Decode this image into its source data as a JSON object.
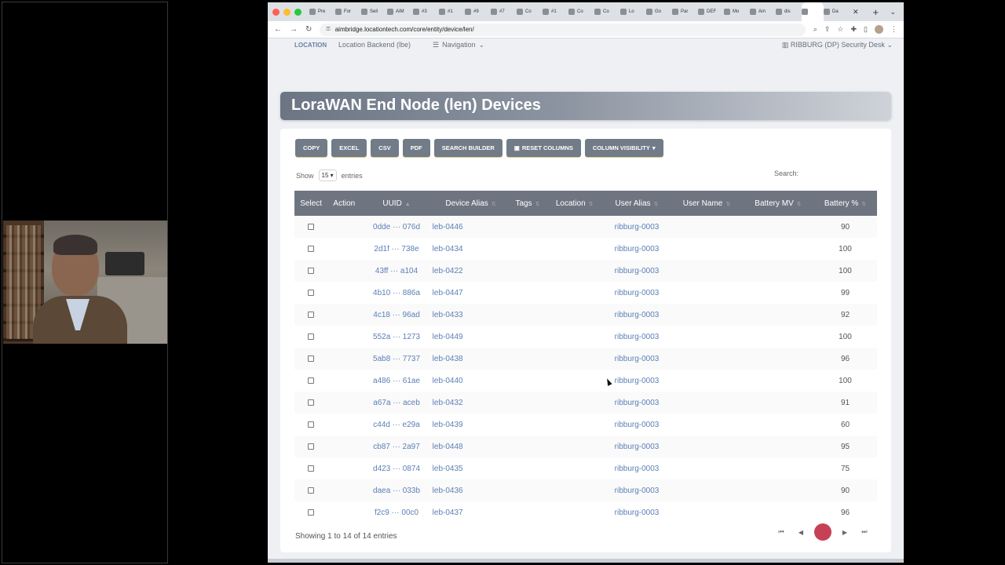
{
  "browser": {
    "tabs": [
      "Pre",
      "For",
      "Sell",
      "AIM",
      "#3",
      "#1",
      "#9",
      "#7",
      "Co",
      "#1",
      "Co",
      "Co",
      "Lo",
      "Go",
      "Par",
      "DEF",
      "Mo",
      "Am",
      "dis",
      "",
      "Da"
    ],
    "url": "aimbridge.locationtech.com/core/entity/device/len/"
  },
  "app": {
    "logo": "LOCATION",
    "name": "Location Backend (lbe)",
    "nav": "Navigation",
    "facility": "RIBBURG (DP) Security Desk"
  },
  "page": {
    "title": "LoraWAN End Node (len) Devices"
  },
  "toolbar": {
    "copy": "COPY",
    "excel": "EXCEL",
    "csv": "CSV",
    "pdf": "PDF",
    "search_builder": "SEARCH BUILDER",
    "reset_columns": "RESET COLUMNS",
    "column_visibility": "COLUMN VISIBILITY"
  },
  "table_controls": {
    "show": "Show",
    "length": "15",
    "entries": "entries",
    "search": "Search:"
  },
  "table": {
    "headers": [
      "Select",
      "Action",
      "UUID",
      "Device Alias",
      "Tags",
      "Location",
      "User Alias",
      "User Name",
      "Battery MV",
      "Battery %"
    ],
    "rows": [
      {
        "uuid": "0dde ··· 076d",
        "alias": "leb-0446",
        "user": "ribburg-0003",
        "pct": "90"
      },
      {
        "uuid": "2d1f ··· 738e",
        "alias": "leb-0434",
        "user": "ribburg-0003",
        "pct": "100"
      },
      {
        "uuid": "43ff ··· a104",
        "alias": "leb-0422",
        "user": "ribburg-0003",
        "pct": "100"
      },
      {
        "uuid": "4b10 ··· 886a",
        "alias": "leb-0447",
        "user": "ribburg-0003",
        "pct": "99"
      },
      {
        "uuid": "4c18 ··· 96ad",
        "alias": "leb-0433",
        "user": "ribburg-0003",
        "pct": "92"
      },
      {
        "uuid": "552a ··· 1273",
        "alias": "leb-0449",
        "user": "ribburg-0003",
        "pct": "100"
      },
      {
        "uuid": "5ab8 ··· 7737",
        "alias": "leb-0438",
        "user": "ribburg-0003",
        "pct": "96"
      },
      {
        "uuid": "a486 ··· 61ae",
        "alias": "leb-0440",
        "user": "ribburg-0003",
        "pct": "100"
      },
      {
        "uuid": "a67a ··· aceb",
        "alias": "leb-0432",
        "user": "ribburg-0003",
        "pct": "91"
      },
      {
        "uuid": "c44d ··· e29a",
        "alias": "leb-0439",
        "user": "ribburg-0003",
        "pct": "60"
      },
      {
        "uuid": "cb87 ··· 2a97",
        "alias": "leb-0448",
        "user": "ribburg-0003",
        "pct": "95"
      },
      {
        "uuid": "d423 ··· 0874",
        "alias": "leb-0435",
        "user": "ribburg-0003",
        "pct": "75"
      },
      {
        "uuid": "daea ··· 033b",
        "alias": "leb-0436",
        "user": "ribburg-0003",
        "pct": "90"
      },
      {
        "uuid": "f2c9 ··· 00c0",
        "alias": "leb-0437",
        "user": "ribburg-0003",
        "pct": "96"
      }
    ]
  },
  "footer": {
    "info": "Showing 1 to 14 of 14 entries",
    "current_page": ""
  },
  "colors": {
    "header_bg": "#6e7581",
    "link": "#5b7fb5",
    "pager_active": "#c64156"
  }
}
